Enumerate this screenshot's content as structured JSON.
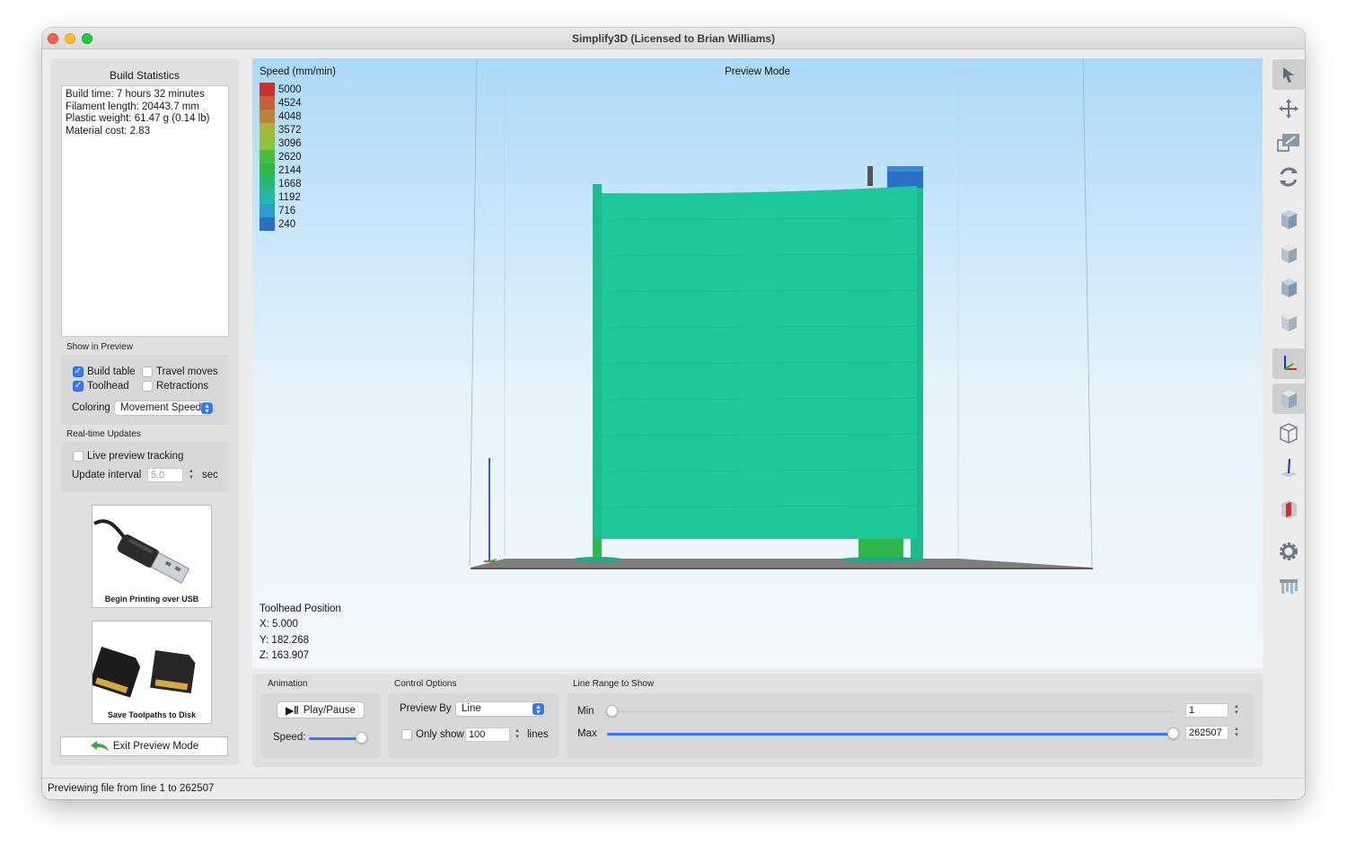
{
  "window": {
    "title": "Simplify3D (Licensed to Brian Williams)"
  },
  "build_statistics": {
    "title": "Build Statistics",
    "lines": [
      "Build time: 7 hours 32 minutes",
      "Filament length: 20443.7 mm",
      "Plastic weight: 61.47 g (0.14 lb)",
      "Material cost: 2.83"
    ]
  },
  "show_in_preview": {
    "label": "Show in Preview",
    "build_table": {
      "label": "Build table",
      "checked": true
    },
    "travel_moves": {
      "label": "Travel moves",
      "checked": false
    },
    "toolhead": {
      "label": "Toolhead",
      "checked": true
    },
    "retractions": {
      "label": "Retractions",
      "checked": false
    },
    "coloring_label": "Coloring",
    "coloring_value": "Movement Speed"
  },
  "realtime": {
    "label": "Real-time Updates",
    "live_tracking": {
      "label": "Live preview tracking",
      "checked": false
    },
    "interval_label": "Update interval",
    "interval_value": "5.0",
    "interval_unit": "sec"
  },
  "usb_button": {
    "label": "Begin Printing over USB"
  },
  "disk_button": {
    "label": "Save Toolpaths to Disk"
  },
  "exit_button": {
    "label": "Exit Preview Mode"
  },
  "viewport": {
    "mode_label": "Preview Mode",
    "legend_title": "Speed (mm/min)",
    "legend": [
      {
        "value": "5000",
        "color": "#c8332e"
      },
      {
        "value": "4524",
        "color": "#c4603a"
      },
      {
        "value": "4048",
        "color": "#b8853a"
      },
      {
        "value": "3572",
        "color": "#a9b53a"
      },
      {
        "value": "3096",
        "color": "#8fc23a"
      },
      {
        "value": "2620",
        "color": "#4cbc3e"
      },
      {
        "value": "2144",
        "color": "#2eb84a"
      },
      {
        "value": "1668",
        "color": "#23b778"
      },
      {
        "value": "1192",
        "color": "#22b7a6"
      },
      {
        "value": "716",
        "color": "#2a9fcf"
      },
      {
        "value": "240",
        "color": "#2a6fc8"
      }
    ],
    "model_color": "#1fc89a",
    "toolhead": {
      "title": "Toolhead Position",
      "x": "X: 5.000",
      "y": "Y: 182.268",
      "z": "Z: 163.907"
    }
  },
  "animation": {
    "label": "Animation",
    "play_label": "Play/Pause",
    "speed_label": "Speed:",
    "speed_level": 0.85
  },
  "control_options": {
    "label": "Control Options",
    "preview_by_label": "Preview By",
    "preview_by_value": "Line",
    "only_show": {
      "label": "Only show",
      "checked": false
    },
    "only_show_value": "100",
    "lines_label": "lines"
  },
  "line_range": {
    "label": "Line Range to Show",
    "min_label": "Min",
    "min_value": "1",
    "max_label": "Max",
    "max_value": "262507",
    "min_level": 0.0,
    "max_level": 1.0
  },
  "toolbar_icons": [
    "select-arrow-icon",
    "move-icon",
    "scale-icon",
    "rotate-icon",
    "view-iso-icon",
    "view-front-icon",
    "view-top-icon",
    "view-side-icon",
    "axes-icon",
    "solid-view-icon",
    "wireframe-view-icon",
    "z-axis-icon",
    "cross-section-icon",
    "gear-icon",
    "supports-icon"
  ],
  "statusbar": {
    "text": "Previewing file from line 1 to 262507"
  }
}
